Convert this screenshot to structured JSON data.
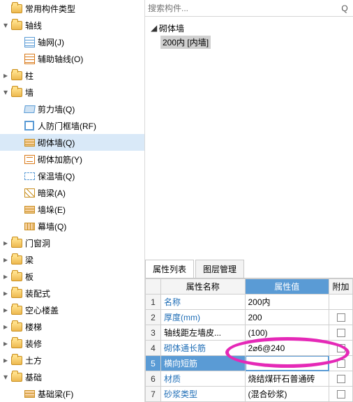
{
  "tree": {
    "root": "常用构件类型",
    "axis": {
      "label": "轴线",
      "items": [
        "轴网(J)",
        "辅助轴线(O)"
      ]
    },
    "column": "柱",
    "wall": {
      "label": "墙",
      "items": [
        "剪力墙(Q)",
        "人防门框墙(RF)",
        "砌体墙(Q)",
        "砌体加筋(Y)",
        "保温墙(Q)",
        "暗梁(A)",
        "墙垛(E)",
        "幕墙(Q)"
      ],
      "selected": 2
    },
    "others": [
      "门窗洞",
      "梁",
      "板",
      "装配式",
      "空心楼盖",
      "楼梯",
      "装修",
      "土方",
      "基础"
    ],
    "foundation_item": "基础梁(F)"
  },
  "search": {
    "placeholder": "搜索构件...",
    "q_icon": "Q"
  },
  "viewer": {
    "group": "砌体墙",
    "selected": "200内  [内墙]"
  },
  "prop": {
    "tabs": [
      "属性列表",
      "图层管理"
    ],
    "headers": {
      "name": "属性名称",
      "value": "属性值",
      "ext": "附加"
    },
    "rows": [
      {
        "n": 1,
        "name": "名称",
        "link": true,
        "value": "200内",
        "cb": false
      },
      {
        "n": 2,
        "name": "厚度(mm)",
        "link": true,
        "value": "200",
        "cb": true
      },
      {
        "n": 3,
        "name": "轴线距左墙皮...",
        "link": false,
        "value": "(100)",
        "cb": true
      },
      {
        "n": 4,
        "name": "砌体通长筋",
        "link": true,
        "value": "2⌀6@240",
        "cb": true
      },
      {
        "n": 5,
        "name": "横向短筋",
        "link": true,
        "value": "",
        "cb": true,
        "sel": true
      },
      {
        "n": 6,
        "name": "材质",
        "link": true,
        "value": "烧结煤矸石普通砖",
        "cb": true
      },
      {
        "n": 7,
        "name": "砂浆类型",
        "link": true,
        "value": "(混合砂浆)",
        "cb": true
      }
    ]
  }
}
